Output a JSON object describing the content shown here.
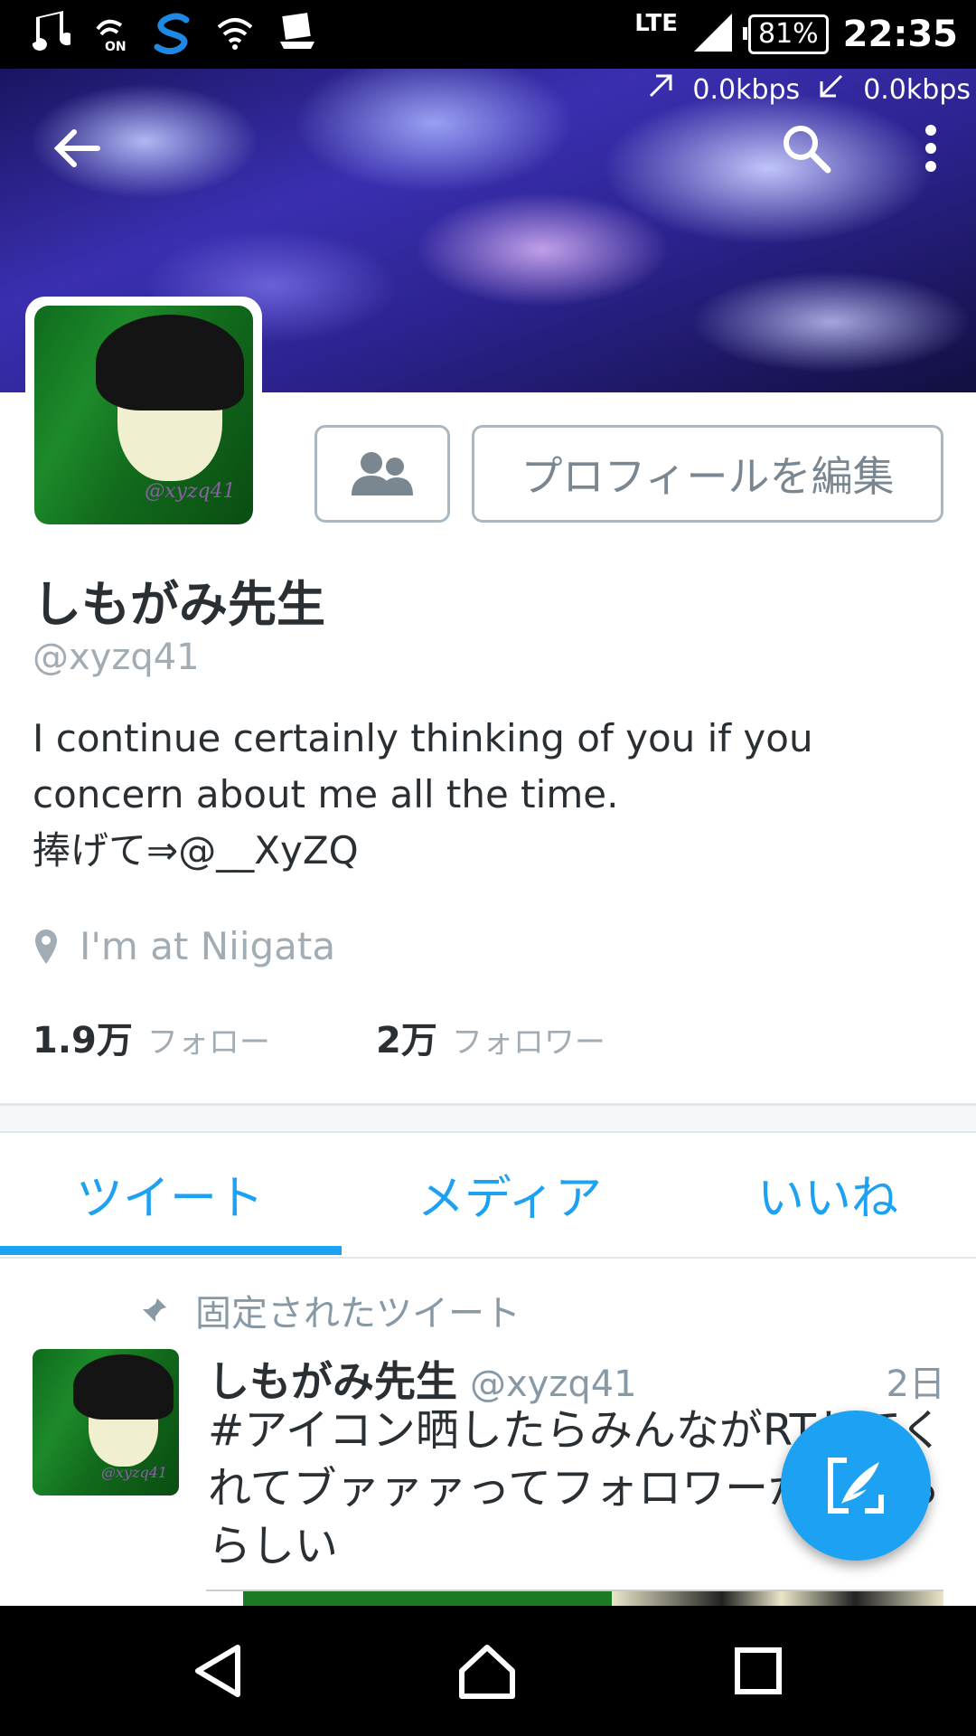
{
  "status_bar": {
    "network": "LTE",
    "battery": "81%",
    "time": "22:35",
    "icons": [
      "music-note-icon",
      "nfc-on-icon",
      "s-app-icon",
      "wifi-icon",
      "cast-icon",
      "signal-icon",
      "battery-icon"
    ]
  },
  "header": {
    "net_up": "0.0kbps",
    "net_down": "0.0kbps"
  },
  "profile": {
    "edit_button": "プロフィールを編集",
    "name": "しもがみ先生",
    "handle": "@xyzq41",
    "avatar_signature": "@xyzq41",
    "bio_lines": [
      "I continue certainly thinking of you if you",
      "concern about me all the time.",
      "捧げて⇒@__XyZQ"
    ],
    "location": "I'm at Niigata",
    "following_count": "1.9万",
    "following_label": "フォロー",
    "followers_count": "2万",
    "followers_label": "フォロワー"
  },
  "tabs": {
    "tweets": "ツイート",
    "media": "メディア",
    "likes": "いいね",
    "active": "tweets"
  },
  "pinned_tweet": {
    "pinned_label": "固定されたツイート",
    "name": "しもがみ先生",
    "handle": "@xyzq41",
    "time": "2日",
    "text": "#アイコン晒したらみんながRTしてくれてブァァァってフォロワーが増えるらしい"
  },
  "colors": {
    "accent": "#1da1f2",
    "text_primary": "#292f33",
    "text_secondary": "#a1acb4"
  }
}
